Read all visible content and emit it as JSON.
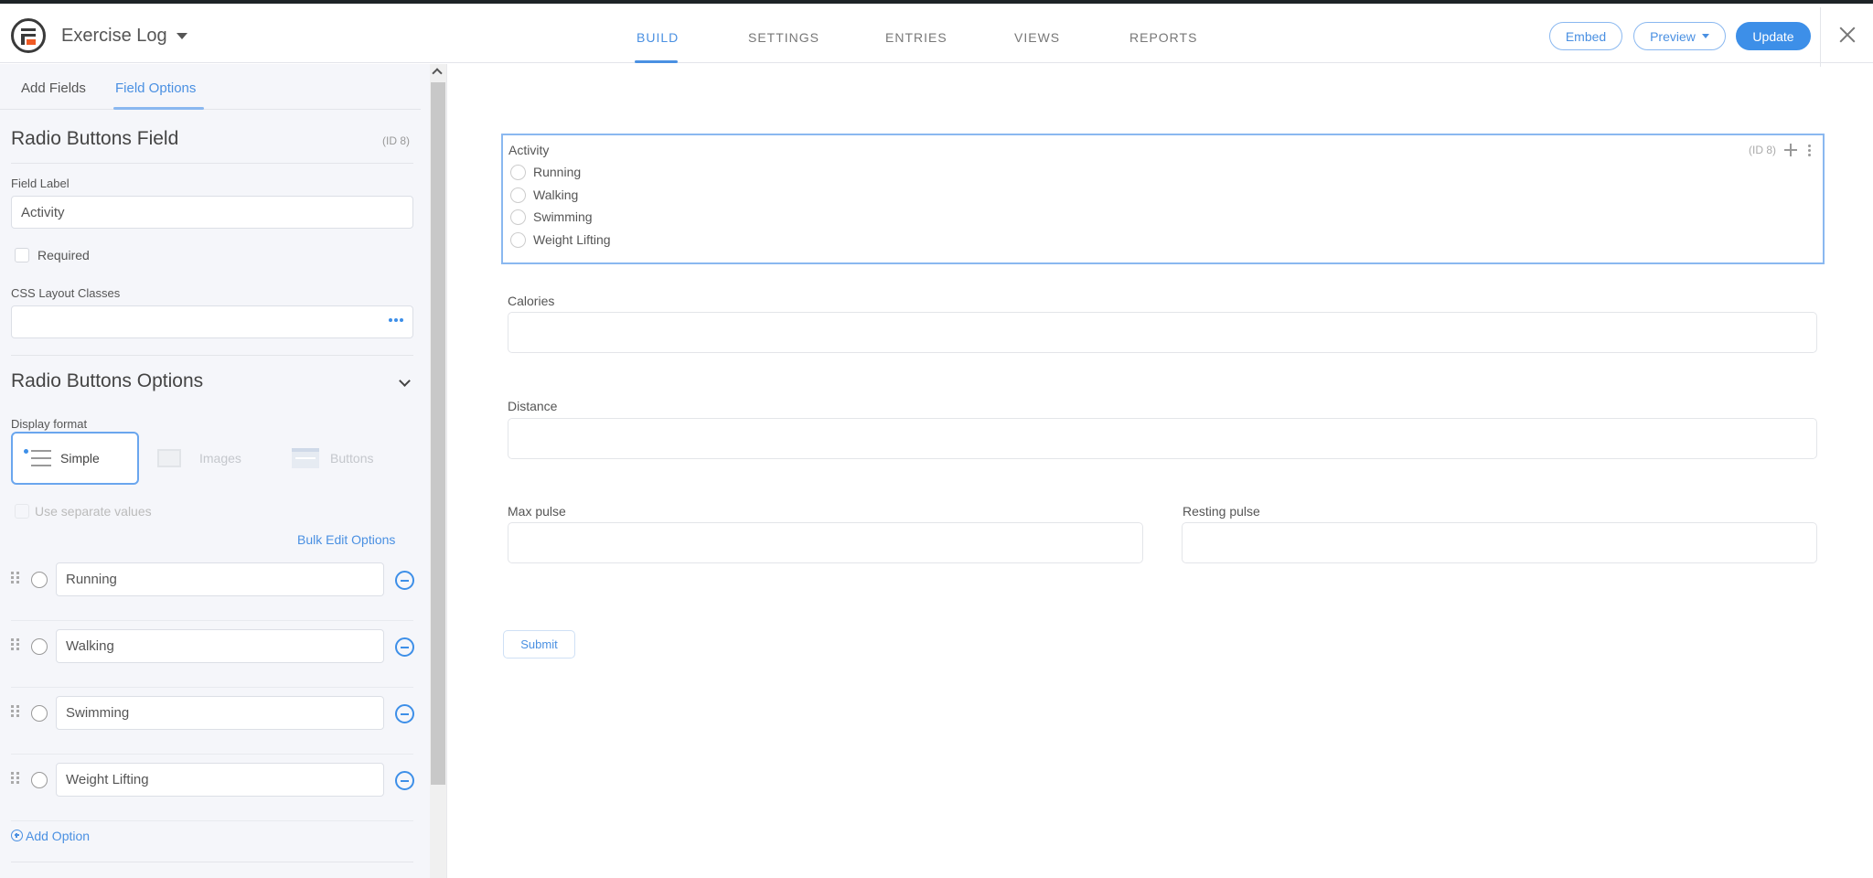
{
  "header": {
    "form_title": "Exercise Log",
    "nav_tabs": [
      {
        "label": "BUILD",
        "active": true
      },
      {
        "label": "SETTINGS",
        "active": false
      },
      {
        "label": "ENTRIES",
        "active": false
      },
      {
        "label": "VIEWS",
        "active": false
      },
      {
        "label": "REPORTS",
        "active": false
      }
    ],
    "embed_label": "Embed",
    "preview_label": "Preview",
    "update_label": "Update"
  },
  "sidebar": {
    "tabs": [
      {
        "label": "Add Fields",
        "active": false
      },
      {
        "label": "Field Options",
        "active": true
      }
    ],
    "field_type_title": "Radio Buttons Field",
    "field_id": "(ID 8)",
    "field_label_caption": "Field Label",
    "field_label_value": "Activity",
    "required_label": "Required",
    "required_checked": false,
    "css_classes_caption": "CSS Layout Classes",
    "css_classes_value": "",
    "options_section_title": "Radio Buttons Options",
    "display_format_caption": "Display format",
    "display_formats": [
      {
        "label": "Simple",
        "selected": true
      },
      {
        "label": "Images",
        "selected": false
      },
      {
        "label": "Buttons",
        "selected": false
      }
    ],
    "separate_values_label": "Use separate values",
    "bulk_edit_label": "Bulk Edit Options",
    "options": [
      "Running",
      "Walking",
      "Swimming",
      "Weight Lifting"
    ],
    "add_option_label": "Add Option"
  },
  "canvas": {
    "activity": {
      "label": "Activity",
      "id_label": "(ID 8)",
      "options": [
        "Running",
        "Walking",
        "Swimming",
        "Weight Lifting"
      ]
    },
    "fields": [
      {
        "label": "Calories",
        "value": ""
      },
      {
        "label": "Distance",
        "value": ""
      },
      {
        "label": "Max pulse",
        "value": ""
      },
      {
        "label": "Resting pulse",
        "value": ""
      }
    ],
    "submit_label": "Submit"
  },
  "colors": {
    "accent": "#4a90e2",
    "primary_button": "#3d8fe8",
    "logo_accent": "#f05a24"
  }
}
